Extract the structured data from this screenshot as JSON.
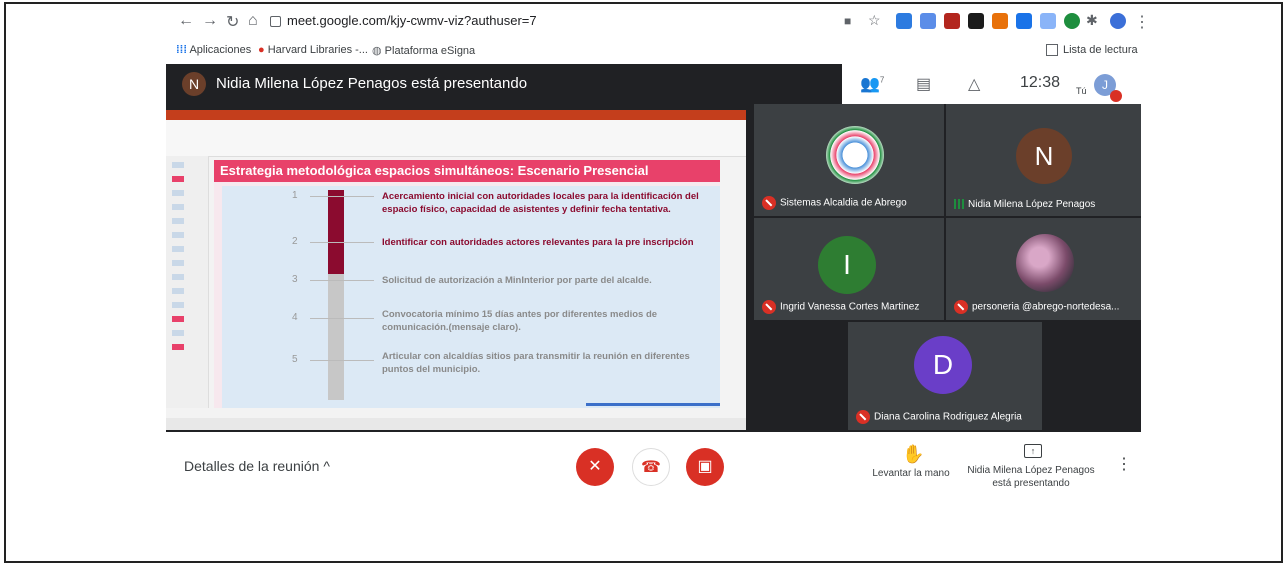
{
  "browser": {
    "url": "meet.google.com/kjy-cwmv-viz?authuser=7",
    "bookmarks": [
      {
        "label": "Aplicaciones"
      },
      {
        "label": "Harvard Libraries -..."
      },
      {
        "label": "Plataforma eSigna"
      }
    ],
    "reading_list": "Lista de lectura"
  },
  "meet": {
    "presenter_initial": "N",
    "presenting_text": "Nidia Milena López Penagos está presentando",
    "people_count": "7",
    "time": "12:38",
    "self_label": "Tú",
    "self_initial": "J",
    "slide": {
      "title": "Estrategia metodológica espacios simultáneos: Escenario Presencial",
      "steps": [
        {
          "num": "1",
          "text": "Acercamiento inicial con autoridades locales para la identificación del espacio físico, capacidad de asistentes y definir fecha tentativa.",
          "active": true
        },
        {
          "num": "2",
          "text": "Identificar con autoridades actores relevantes para la pre inscripción",
          "active": true
        },
        {
          "num": "3",
          "text": "Solicitud de autorización a MinInterior por parte del alcalde.",
          "active": false
        },
        {
          "num": "4",
          "text": "Convocatoria mínimo 15 días antes por diferentes medios de comunicación.(mensaje claro).",
          "active": false
        },
        {
          "num": "5",
          "text": "Articular con alcaldías sitios para transmitir la reunión en diferentes puntos del municipio.",
          "active": false
        }
      ]
    },
    "participants": [
      {
        "name": "Sistemas Alcaldia de Abrego",
        "muted": true
      },
      {
        "name": "Nidia Milena López Penagos",
        "initial": "N",
        "muted": false
      },
      {
        "name": "Ingrid Vanessa Cortes Martinez",
        "initial": "I",
        "muted": true
      },
      {
        "name": "personeria @abrego-nortedesa...",
        "muted": true
      },
      {
        "name": "Diana Carolina Rodriguez Alegria",
        "initial": "D",
        "muted": true
      }
    ],
    "bottom": {
      "details": "Detalles de la reunión",
      "raise_hand": "Levantar la mano",
      "presenting_line1": "Nidia Milena López Penagos",
      "presenting_line2": "está presentando"
    }
  },
  "colors": {
    "meet_dark": "#202124",
    "tile": "#3c4043",
    "mute_red": "#d93025",
    "slide_title": "#e8416a",
    "slide_active": "#8b0b2f"
  }
}
